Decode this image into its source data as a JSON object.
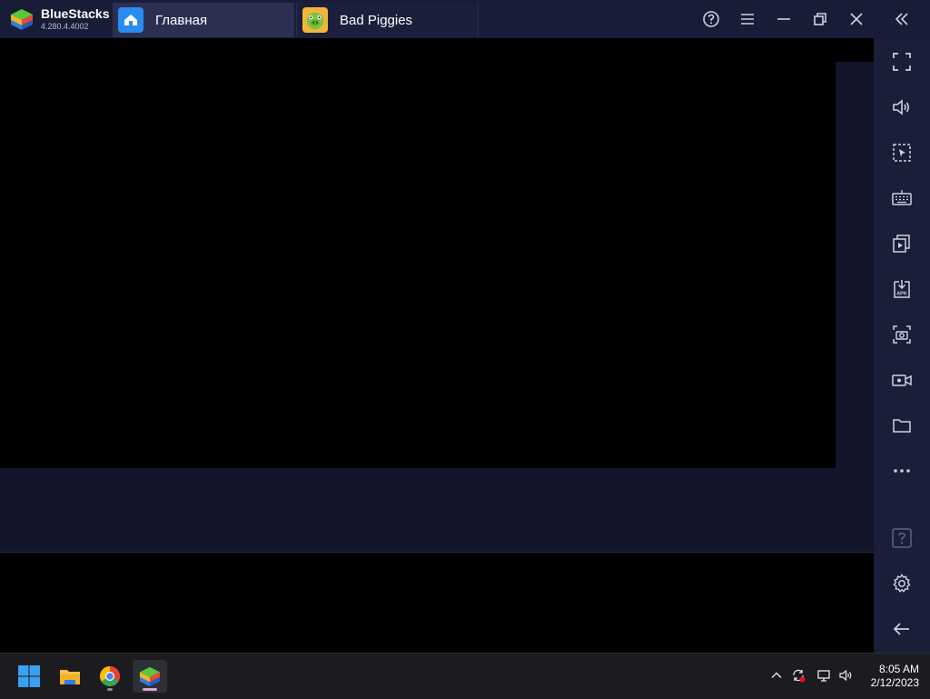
{
  "app": {
    "name": "BlueStacks",
    "version": "4.280.4.4002"
  },
  "tabs": [
    {
      "label": "Главная",
      "icon": "home-icon",
      "active": true
    },
    {
      "label": "Bad Piggies",
      "icon": "bad-piggies-app-icon",
      "active": false
    }
  ],
  "window_controls": [
    "help-icon",
    "menu-icon",
    "minimize-icon",
    "restore-icon",
    "close-icon",
    "collapse-sidebar-icon"
  ],
  "sidebar": {
    "buttons": [
      "fullscreen-icon",
      "volume-icon",
      "keymapping-icon",
      "keyboard-icon",
      "multi-instance-icon",
      "install-apk-icon",
      "screenshot-icon",
      "record-video-icon",
      "media-folder-icon",
      "more-icon",
      "help-icon",
      "settings-icon",
      "back-icon"
    ]
  },
  "taskbar": {
    "apps": [
      "windows-start-icon",
      "file-explorer-icon",
      "chrome-icon",
      "bluestacks-icon"
    ],
    "tray": [
      "show-hidden-icons-chevron",
      "sync-icon",
      "network-icon",
      "speaker-icon"
    ],
    "clock": {
      "time": "8:05 AM",
      "date": "2/12/2023"
    }
  },
  "colors": {
    "titlebar": "#181c36",
    "active_tab": "#2b3052",
    "sidebar": "#1a1e38",
    "taskbar": "#1c1c20"
  }
}
